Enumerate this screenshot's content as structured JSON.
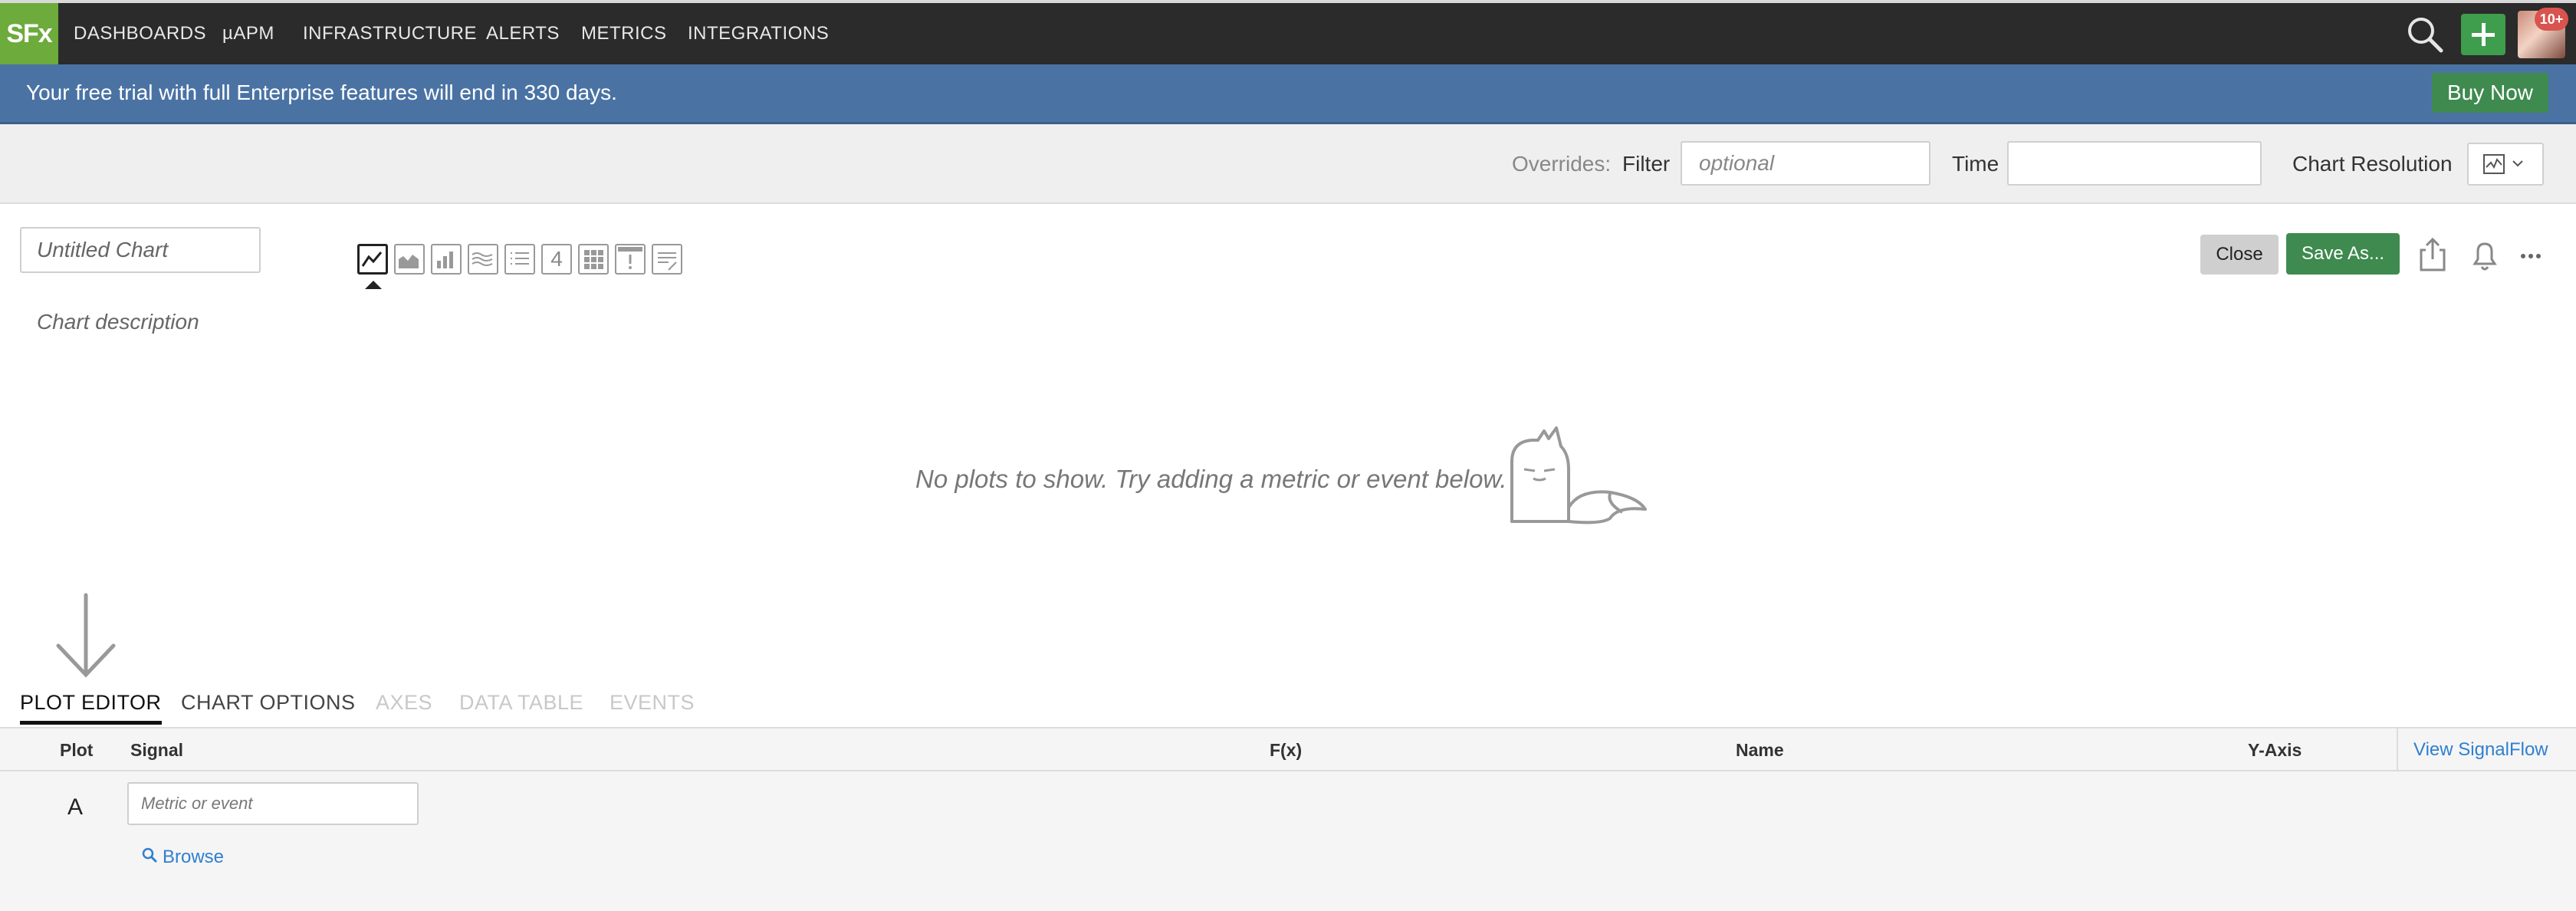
{
  "topnav": {
    "logo": "SFx",
    "items": [
      "DASHBOARDS",
      "µAPM",
      "INFRASTRUCTURE",
      "ALERTS",
      "METRICS",
      "INTEGRATIONS"
    ],
    "notifications_badge": "10+"
  },
  "banner": {
    "text": "Your free trial with full Enterprise features will end in 330 days.",
    "buy_label": "Buy Now"
  },
  "overrides": {
    "label": "Overrides:",
    "filter_label": "Filter",
    "filter_placeholder": "optional",
    "time_label": "Time",
    "time_value": "",
    "resolution_label": "Chart Resolution"
  },
  "chart": {
    "title_placeholder": "Untitled Chart",
    "description_placeholder": "Chart description",
    "type_icons": [
      "line-chart-icon",
      "area-chart-icon",
      "column-chart-icon",
      "histogram-icon",
      "list-icon",
      "single-value-icon",
      "heatmap-icon",
      "event-feed-icon",
      "text-note-icon"
    ],
    "single_value_glyph": "4",
    "close_label": "Close",
    "save_as_label": "Save As..."
  },
  "empty_state": {
    "message": "No plots to show. Try adding a metric or event below."
  },
  "tabs": [
    {
      "label": "PLOT EDITOR",
      "state": "active"
    },
    {
      "label": "CHART OPTIONS",
      "state": "normal"
    },
    {
      "label": "AXES",
      "state": "disabled"
    },
    {
      "label": "DATA TABLE",
      "state": "disabled"
    },
    {
      "label": "EVENTS",
      "state": "disabled"
    }
  ],
  "editor": {
    "columns": {
      "plot": "Plot",
      "signal": "Signal",
      "fx": "F(x)",
      "name": "Name",
      "yaxis": "Y-Axis"
    },
    "view_signalflow": "View SignalFlow",
    "row": {
      "letter": "A",
      "metric_placeholder": "Metric or event",
      "browse_label": "Browse"
    }
  },
  "colors": {
    "nav_bg": "#2b2b2b",
    "logo_green": "#6dab3c",
    "banner_blue": "#4a73a4",
    "action_green": "#3f8a4f",
    "link_blue": "#2f7fd1"
  }
}
